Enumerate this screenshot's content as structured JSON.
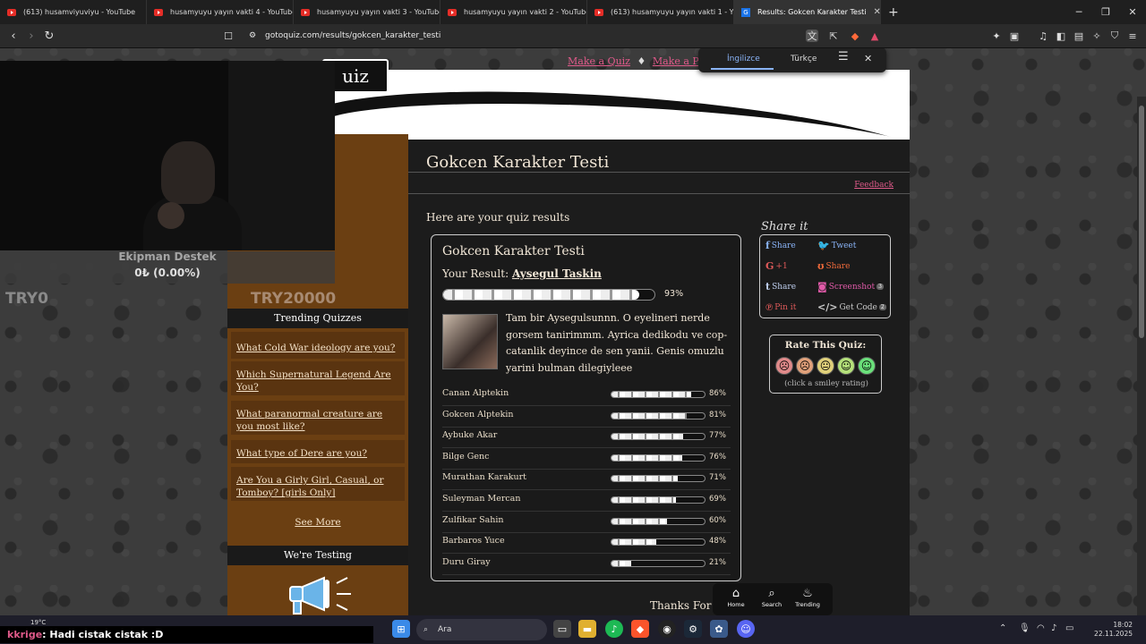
{
  "browser": {
    "tabs": [
      {
        "label": "(613) husamviyuviyu - YouTube",
        "active": false,
        "favicon": "youtube-icon"
      },
      {
        "label": "husamyuyu yayın vakti 4 - YouTube",
        "active": false,
        "favicon": "youtube-icon"
      },
      {
        "label": "husamyuyu yayın vakti 3 - YouTube",
        "active": false,
        "favicon": "youtube-icon"
      },
      {
        "label": "husamyuyu yayın vakti 2 - YouTube",
        "active": false,
        "favicon": "youtube-icon"
      },
      {
        "label": "(613) husamyuyu yayın vakti 1 - You",
        "active": false,
        "favicon": "youtube-icon"
      },
      {
        "label": "Results: Gokcen Karakter Testi",
        "active": true,
        "favicon": "gotoquiz-icon"
      }
    ],
    "url": "gotoquiz.com/results/gokcen_karakter_testi"
  },
  "translate_popup": {
    "lang1": "İngilizce",
    "lang2": "Türkçe"
  },
  "site": {
    "logo_text": "uiz",
    "nav": {
      "make_quiz": "Make a Quiz",
      "make_poll": "Make a Poll",
      "sep": "♦"
    }
  },
  "sidebar": {
    "donation_amount": "TRY20000",
    "trending_title": "Trending Quizzes",
    "trending": [
      "What Cold War ideology are you?",
      "Which Supernatural Legend Are You?",
      "What paranormal creature are you most like?",
      "What type of Dere are you?",
      "Are You a Girly Girl, Casual, or Tomboy? [girls Only]"
    ],
    "see_more": "See More",
    "testing_title": "We're Testing"
  },
  "main": {
    "quiz_title": "Gokcen Karakter Testi",
    "feedback": "Feedback",
    "intro": "Here are your quiz results",
    "card_title": "Gokcen Karakter Testi",
    "your_result_label": "Your Result:",
    "result_name": "Aysegul Taskin",
    "result_pct": "93%",
    "result_value": 93,
    "description": "Tam bir Aysegulsunnn. O eyelineri nerde gorsem tanirimmm. Ayrica dedikodu ve cop-catanlik deyince de sen yanii. Genis omuzlu yarini bulman dilegiyleee",
    "others": [
      {
        "name": "Canan Alptekin",
        "pct": "86%",
        "value": 86
      },
      {
        "name": "Gokcen Alptekin",
        "pct": "81%",
        "value": 81
      },
      {
        "name": "Aybuke Akar",
        "pct": "77%",
        "value": 77
      },
      {
        "name": "Bilge Genc",
        "pct": "76%",
        "value": 76
      },
      {
        "name": "Murathan Karakurt",
        "pct": "71%",
        "value": 71
      },
      {
        "name": "Suleyman Mercan",
        "pct": "69%",
        "value": 69
      },
      {
        "name": "Zulfikar Sahin",
        "pct": "60%",
        "value": 60
      },
      {
        "name": "Barbaros Yuce",
        "pct": "48%",
        "value": 48
      },
      {
        "name": "Duru Giray",
        "pct": "21%",
        "value": 21
      }
    ],
    "thanks": "Thanks For V"
  },
  "share": {
    "title": "Share it",
    "items": [
      {
        "label": "Share",
        "icon": "facebook-icon",
        "color": "#8ab4f8"
      },
      {
        "label": "Tweet",
        "icon": "twitter-icon",
        "color": "#8ab4f8"
      },
      {
        "label": "+1",
        "icon": "googleplus-icon",
        "color": "#e05a5a"
      },
      {
        "label": "Share",
        "icon": "stumbleupon-icon",
        "color": "#f06a3a"
      },
      {
        "label": "Share",
        "icon": "tumblr-icon",
        "color": "#c0d0f0"
      },
      {
        "label": "Screenshot",
        "icon": "camera-icon",
        "color": "#e05aa8",
        "count": "3"
      },
      {
        "label": "Pin it",
        "icon": "pinterest-icon",
        "color": "#e05a5a"
      },
      {
        "label": "Get Code",
        "icon": "code-icon",
        "color": "#ccc",
        "count": "2"
      }
    ]
  },
  "rating": {
    "title": "Rate This Quiz:",
    "hint": "(click a smiley rating)",
    "smileys": [
      "very-sad-smiley-icon",
      "sad-smiley-icon",
      "neutral-smiley-icon",
      "happy-smiley-icon",
      "very-happy-smiley-icon"
    ]
  },
  "bottom_nav": {
    "home": "Home",
    "search": "Search",
    "trending": "Trending"
  },
  "stream_overlay": {
    "ekipman_title": "Ekipman Destek",
    "ekipman_value": "0₺ (0.00%)",
    "try0": "TRY0",
    "chat_user": "kkrige",
    "chat_msg": ": Hadi cistak cistak :D"
  },
  "taskbar": {
    "weather": "19°C",
    "search_placeholder": "Ara",
    "time": "18:02",
    "date": "22.11.2025"
  },
  "colors": {
    "accent_pink": "#e05a8a",
    "sidebar_brown": "#6b3f12",
    "main_bg": "#1c1c1c"
  }
}
